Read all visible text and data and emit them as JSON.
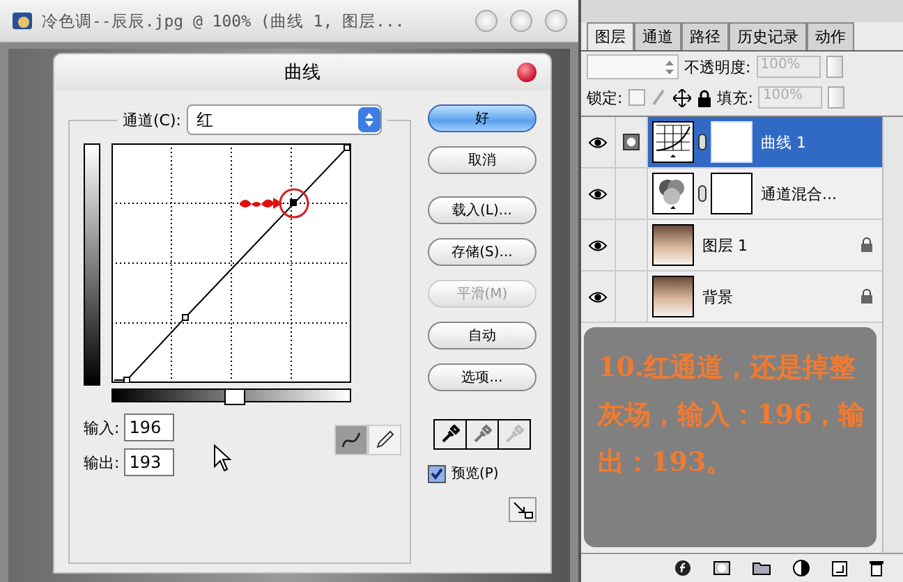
{
  "document_window": {
    "title": "冷色调--辰辰.jpg @ 100% (曲线 1, 图层..."
  },
  "curves_dialog": {
    "title": "曲线",
    "channel_label": "通道(C):",
    "channel_value": "红",
    "input_label": "输入:",
    "input_value": "196",
    "output_label": "输出:",
    "output_value": "193",
    "tools": [
      {
        "kind": "curve",
        "selected": true
      },
      {
        "kind": "pencil",
        "selected": false
      }
    ],
    "buttons": [
      {
        "label": "好",
        "default": true,
        "disabled": false
      },
      {
        "label": "取消",
        "default": false,
        "disabled": false
      },
      {
        "label": "载入(L)...",
        "default": false,
        "disabled": false
      },
      {
        "label": "存储(S)...",
        "default": false,
        "disabled": false
      },
      {
        "label": "平滑(M)",
        "default": false,
        "disabled": true
      },
      {
        "label": "自动",
        "default": false,
        "disabled": false
      },
      {
        "label": "选项...",
        "default": false,
        "disabled": false
      }
    ],
    "preview": {
      "label": "预览(P)",
      "checked": true
    }
  },
  "layers_panel": {
    "tabs": [
      {
        "label": "图层",
        "selected": true
      },
      {
        "label": "通道",
        "selected": false
      },
      {
        "label": "路径",
        "selected": false
      },
      {
        "label": "历史记录",
        "selected": false
      },
      {
        "label": "动作",
        "selected": false
      }
    ],
    "opacity_label": "不透明度:",
    "opacity_value": "100%",
    "lock_label": "锁定:",
    "fill_label": "填充:",
    "fill_value": "100%",
    "layers": [
      {
        "name": "曲线 1",
        "kind": "curves",
        "selected": true,
        "visible": true,
        "locked": false
      },
      {
        "name": "通道混合...",
        "kind": "mixer",
        "selected": false,
        "visible": true,
        "locked": false
      },
      {
        "name": "图层 1",
        "kind": "photo",
        "selected": false,
        "visible": true,
        "locked": true
      },
      {
        "name": "背景",
        "kind": "photo",
        "selected": false,
        "visible": true,
        "locked": true
      }
    ]
  },
  "note": {
    "text": "10.红通道，还是掉整灰场，输入：196，输出：193。"
  }
}
